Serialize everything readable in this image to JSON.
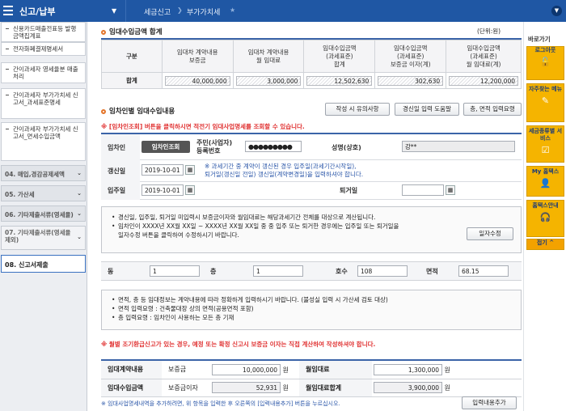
{
  "topbar": {
    "title": "신고/납부",
    "crumbs": [
      "세금신고",
      "부가가치세"
    ]
  },
  "sidebar": {
    "items": [
      {
        "label": "신용카드매출전표등 발행금액집계표"
      },
      {
        "label": "전자화폐결제명세서"
      },
      {
        "label": "간이과세자 영세율분 매출 처리"
      },
      {
        "label": "간이과세자 부가가치세 신고서_과세표준명세"
      },
      {
        "label": "간이과세자 부가가치세 신고서_면세수입금액"
      }
    ],
    "groups": [
      {
        "label": "04. 매입,경감공제세액"
      },
      {
        "label": "05. 가산세"
      },
      {
        "label": "06. 기타제출서류(영세율)"
      },
      {
        "label": "07. 기타제출서류(영세율 제외)"
      }
    ],
    "active": "08. 신고서제출"
  },
  "summary": {
    "title": "임대수입금액 합계",
    "unit": "(단위:원)",
    "headers": [
      "구분",
      "임대차 계약내용\n보증금",
      "임대차 계약내용\n월 임대료",
      "임대수입금액\n(과세표준)\n합계",
      "임대수입금액\n(과세표준)\n보증금 이자(계)",
      "임대수입금액\n(과세표준)\n월 임대료(계)"
    ],
    "row_label": "합계",
    "values": [
      "40,000,000",
      "3,000,000",
      "12,502,630",
      "302,630",
      "12,200,000"
    ]
  },
  "detail": {
    "title": "임차인별 임대수입내용",
    "buttons": [
      "작성 시 유의사항",
      "경신일 입력 도움말",
      "층, 면적 입력요령"
    ],
    "warning": "※ [임차인조회] 버튼을 클릭하시면 적전기 임대사업명세를 조회할 수 있습니다.",
    "tenant_label": "임차인",
    "tenant_btn": "임차인조회",
    "reg_label": "주민(사업자)\n등록번호",
    "reg_value": "●●●●●●●●●",
    "name_label": "성명(상호)",
    "name_value": "강**",
    "renew_label": "갱신일",
    "renew_value": "2019-10-01",
    "renew_note": "※ 과세기간 중 계약이 갱신된 경우 입주일(과세기간시작일),\n   퇴거일(갱신일 전일) 갱신일(계약변경일)을 입력하셔야 합니다.",
    "move_in_label": "입주일",
    "move_in_value": "2019-10-01",
    "move_out_label": "퇴거일",
    "move_out_value": ""
  },
  "info1": {
    "lines": [
      "경신일, 입주일, 퇴거일 미입력시 보증금이자와 월임대료는 해당과세기간 전체를 대상으로 계산됩니다.",
      "임차인이 XXXX년 XX월 XX일 ~ XXXX년 XX월 XX일 중 중 입주 또는 퇴거한 경우에는 입주일 또는 퇴거일을\n일자수정 버튼을 클릭하여 수정하시기 바랍니다."
    ],
    "button": "일자수정"
  },
  "unit_row": {
    "dong_label": "동",
    "dong_value": "1",
    "floor_label": "층",
    "floor_value": "1",
    "ho_label": "호수",
    "ho_value": "108",
    "area_label": "면적",
    "area_value": "68.15"
  },
  "info2": {
    "lines": [
      "면적, 층 등 임대정보는 계약내용에 따라 정확하게 입력하시기 바랍니다. (불성실 입력 시 가산세 검토 대상)",
      "면적 입력요령 : 건축물대장 상의 면적(공용면적 포함)",
      "층 입력요령 : 임차인이 사용하는 모든 층 기재"
    ]
  },
  "warning2": "※ 월별 조기환급신고가 있는 경우, 예정 또는 확정 신고시 보증금 이자는 직접 계산하여 작성하셔야 합니다.",
  "bottom": {
    "contract_label": "임대계약내용",
    "deposit_label": "보증금",
    "deposit_value": "10,000,000",
    "monthly_label": "월임대료",
    "monthly_value": "1,300,000",
    "income_label": "임대수입금액",
    "interest_label": "보증금이자",
    "interest_value": "52,931",
    "monthly_total_label": "월임대료합계",
    "monthly_total_value": "3,900,000",
    "won": "원",
    "note": "※ 임대사업명세내역을 추가하려면, 위 항목을 입력한 후 오른쪽의 [입력내용추가] 버튼을 누르십시오.",
    "add_btn": "입력내용추가"
  },
  "quick": {
    "title": "바로가기",
    "items": [
      "로그아웃",
      "자주찾는 메뉴",
      "세금종류별 서비스",
      "My 홈택스",
      "홈택스안내"
    ],
    "close": "접기 ^"
  }
}
